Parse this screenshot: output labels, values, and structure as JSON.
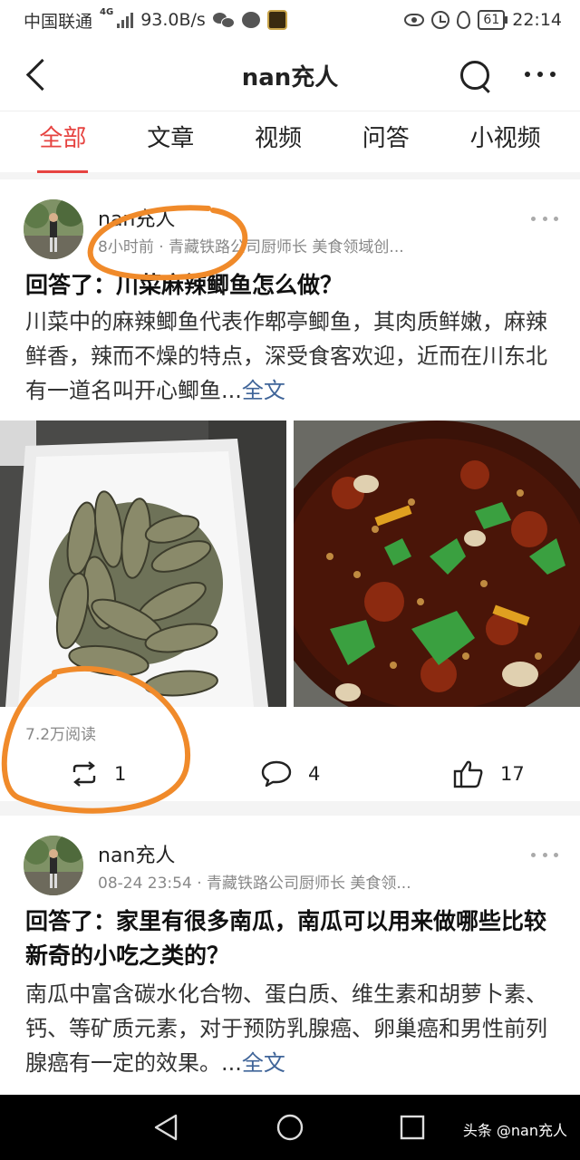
{
  "status_bar": {
    "carrier": "中国联通",
    "network": "4G",
    "speed": "93.0B/s",
    "battery": "61",
    "time": "22:14"
  },
  "nav": {
    "title": "nan充人"
  },
  "tabs": [
    {
      "label": "全部",
      "active": true
    },
    {
      "label": "文章",
      "active": false
    },
    {
      "label": "视频",
      "active": false
    },
    {
      "label": "问答",
      "active": false
    },
    {
      "label": "小视频",
      "active": false
    }
  ],
  "posts": [
    {
      "author": "nan充人",
      "meta": "8小时前 · 青藏铁路公司厨师长 美食领域创...",
      "headline": "回答了：川菜麻辣鲫鱼怎么做？",
      "excerpt": "川菜中的麻辣鲫鱼代表作郫亭鲫鱼，其肉质鲜嫩，麻辣鲜香，辣而不燥的特点，深受食客欢迎，近而在川东北有一道名叫开心鲫鱼...",
      "full_link": "全文",
      "reads": "7.2万阅读",
      "reposts": "1",
      "comments": "4",
      "likes": "17"
    },
    {
      "author": "nan充人",
      "meta": "08-24 23:54 · 青藏铁路公司厨师长 美食领...",
      "headline": "回答了：家里有很多南瓜，南瓜可以用来做哪些比较新奇的小吃之类的？",
      "excerpt": "南瓜中富含碳水化合物、蛋白质、维生素和胡萝卜素、钙、等矿质元素，对于预防乳腺癌、卵巢癌和男性前列腺癌有一定的效果。...",
      "full_link": "全文"
    }
  ],
  "watermark": "头条 @nan充人",
  "colors": {
    "accent": "#e64340",
    "link": "#406599",
    "annotation": "#f08a2a"
  },
  "icons": {
    "back": "chevron-left-icon",
    "search": "search-icon",
    "more": "more-icon",
    "repost": "repost-icon",
    "comment": "comment-icon",
    "like": "thumbs-up-icon"
  }
}
